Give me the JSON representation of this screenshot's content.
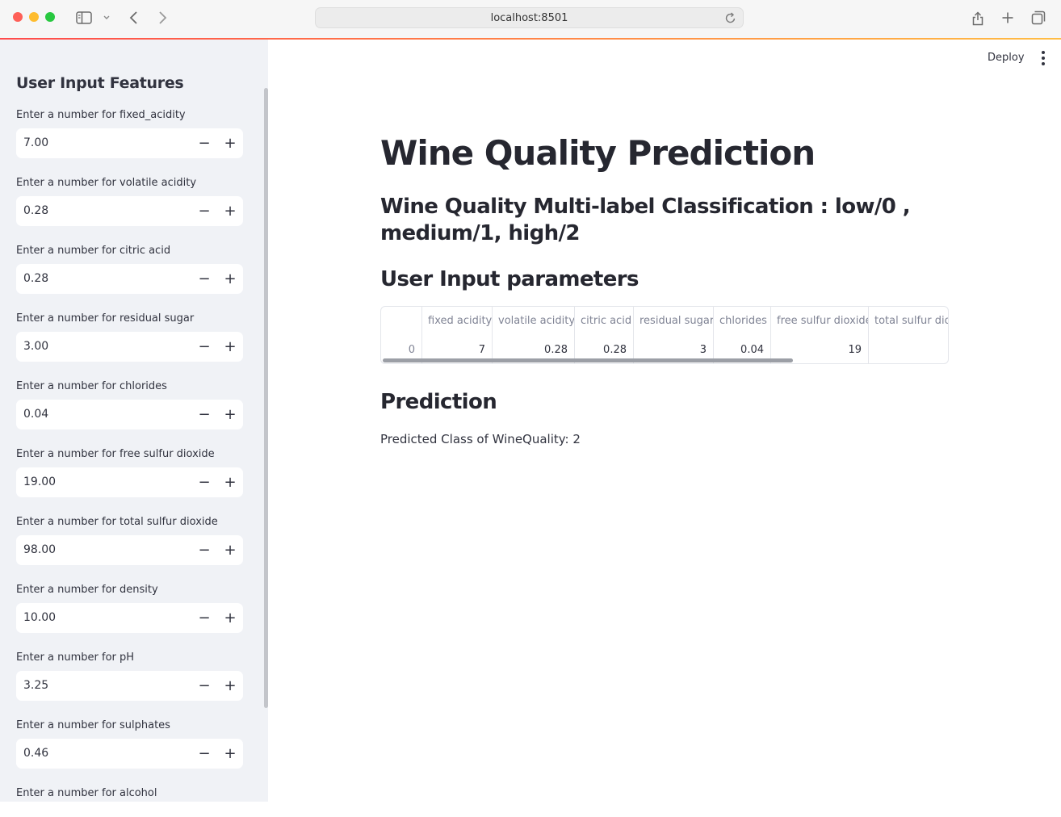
{
  "browser": {
    "url": "localhost:8501"
  },
  "header": {
    "deploy_label": "Deploy"
  },
  "sidebar": {
    "title": "User Input Features",
    "fields": [
      {
        "label": "Enter a number for fixed_acidity",
        "value": "7.00"
      },
      {
        "label": "Enter a number for volatile acidity",
        "value": "0.28"
      },
      {
        "label": "Enter a number for citric acid",
        "value": "0.28"
      },
      {
        "label": "Enter a number for residual sugar",
        "value": "3.00"
      },
      {
        "label": "Enter a number for chlorides",
        "value": "0.04"
      },
      {
        "label": "Enter a number for free sulfur dioxide",
        "value": "19.00"
      },
      {
        "label": "Enter a number for total sulfur dioxide",
        "value": "98.00"
      },
      {
        "label": "Enter a number for density",
        "value": "10.00"
      },
      {
        "label": "Enter a number for pH",
        "value": "3.25"
      },
      {
        "label": "Enter a number for sulphates",
        "value": "0.46"
      },
      {
        "label": "Enter a number for alcohol",
        "value": ""
      }
    ],
    "minus_glyph": "−",
    "plus_glyph": "+"
  },
  "main": {
    "title": "Wine Quality Prediction",
    "subtitle": "Wine Quality Multi-label Classification : low/0 , medium/1, high/2",
    "params_heading": "User Input parameters",
    "table": {
      "columns": [
        "",
        "fixed acidity",
        "volatile acidity",
        "citric acid",
        "residual sugar",
        "chlorides",
        "free sulfur dioxide",
        "total sulfur diox"
      ],
      "rows": [
        [
          "0",
          "7",
          "0.28",
          "0.28",
          "3",
          "0.04",
          "19",
          ""
        ]
      ]
    },
    "prediction_heading": "Prediction",
    "prediction_text": "Predicted Class of WineQuality: 2"
  },
  "colors": {
    "sidebar_bg": "#f0f2f6",
    "accent_start": "#ff4b4b",
    "accent_end": "#ffbd45",
    "text": "#31333f"
  },
  "icons": [
    "sidebar-toggle-icon",
    "chevron-down-icon",
    "back-icon",
    "forward-icon",
    "reload-icon",
    "share-icon",
    "new-tab-icon",
    "tabs-overview-icon",
    "more-vertical-icon"
  ]
}
